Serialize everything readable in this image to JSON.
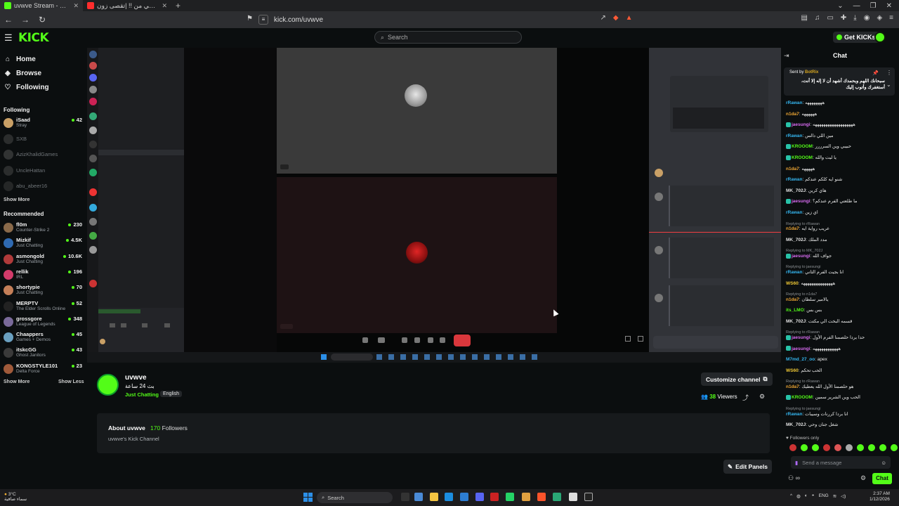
{
  "browser": {
    "tabs": [
      {
        "title": "uvwve Stream - Watch Live on K",
        "active": true
      },
      {
        "title": "الاستقاضي من !! |تقصى زون - YouTube",
        "active": false
      }
    ],
    "url": "kick.com/uvwve"
  },
  "header": {
    "logo": "KICK",
    "search_placeholder": "Search",
    "get_kicks": "Get KICKs"
  },
  "sidebar": {
    "nav": [
      {
        "label": "Home",
        "icon": "home-icon"
      },
      {
        "label": "Browse",
        "icon": "compass-icon"
      },
      {
        "label": "Following",
        "icon": "heart-icon"
      }
    ],
    "following_heading": "Following",
    "following": [
      {
        "name": "iSaad",
        "category": "Stray",
        "viewers": "42",
        "live": true,
        "color": "#c9a066"
      },
      {
        "name": "SXB",
        "category": "",
        "viewers": "",
        "live": false,
        "color": "#666"
      },
      {
        "name": "AzizKhalidGames",
        "category": "",
        "viewers": "",
        "live": false,
        "color": "#777"
      },
      {
        "name": "UncleHattan",
        "category": "",
        "viewers": "",
        "live": false,
        "color": "#666"
      },
      {
        "name": "abu_abeer16",
        "category": "",
        "viewers": "",
        "live": false,
        "color": "#555"
      }
    ],
    "show_more": "Show More",
    "recommended_heading": "Recommended",
    "recommended": [
      {
        "name": "fl0m",
        "category": "Counter-Strike 2",
        "viewers": "230",
        "color": "#8a6a4a"
      },
      {
        "name": "Mizkif",
        "category": "Just Chatting",
        "viewers": "4.5K",
        "color": "#2f6ab1"
      },
      {
        "name": "asmongold",
        "category": "Just Chatting",
        "viewers": "10.6K",
        "color": "#b03a3a"
      },
      {
        "name": "rellik",
        "category": "IRL",
        "viewers": "196",
        "color": "#d23b6a"
      },
      {
        "name": "shortypie",
        "category": "Just Chatting",
        "viewers": "70",
        "color": "#c47f58"
      },
      {
        "name": "MERPTV",
        "category": "The Elder Scrolls Online",
        "viewers": "52",
        "color": "#222"
      },
      {
        "name": "grossgore",
        "category": "League of Legends",
        "viewers": "348",
        "color": "#7a6a9a"
      },
      {
        "name": "Chaappers",
        "category": "Games + Demos",
        "viewers": "45",
        "color": "#6aa0c0"
      },
      {
        "name": "itskcGG",
        "category": "Ghost Janitors",
        "viewers": "43",
        "color": "#3a3a3a"
      },
      {
        "name": "KONGSTYLE101",
        "category": "Delta Force",
        "viewers": "23",
        "color": "#a05a3a"
      }
    ],
    "show_more_bottom": "Show More",
    "show_less": "Show Less"
  },
  "stream": {
    "channel": "uvwve",
    "title": "بث 24 ساعة",
    "category": "Just Chatting",
    "language": "English",
    "customize": "Customize channel",
    "viewers_count": "38",
    "viewers_label": "Viewers",
    "about_label": "About uvwve",
    "followers_count": "170",
    "followers_label": "Followers",
    "description": "uvwve's Kick Channel",
    "edit_panels": "Edit Panels"
  },
  "chat": {
    "title": "Chat",
    "pinned_by_label": "Sent by",
    "pinned_by": "BotRix",
    "pinned_text": "سبحانك اللهم وبحمدك أشهد أن لا إله إلا أنت، أستغفرك وأتوب إليك",
    "messages": [
      {
        "user": "rRawan",
        "text": ": ههههههههه",
        "color": "#35b6f0"
      },
      {
        "user": "n1da7",
        "text": ": ههههههه",
        "color": "#f0a835"
      },
      {
        "user": "jaesungi",
        "text": ": هههههههههههههههههههه",
        "color": "#d76bf0",
        "badge": true
      },
      {
        "user": "rRawan",
        "text": ": مين اللي دالس",
        "color": "#35b6f0"
      },
      {
        "user": "KROOOM",
        "text": ": حبيبي وين السرررر",
        "color": "#53fc18",
        "badge": true
      },
      {
        "user": "KROOOM",
        "text": ": يا ليت والله",
        "color": "#53fc18",
        "badge": true
      },
      {
        "user": "n1da7",
        "text": ": هههههه",
        "color": "#f0a835"
      },
      {
        "user": "rRawan",
        "text": ": شنو ايه كلكم عندكم",
        "color": "#35b6f0"
      },
      {
        "user": "MK_702J",
        "text": ": هاي كرين",
        "color": "#e0e0e0"
      },
      {
        "user": "jaesungi",
        "text": ": ما طلعتي الفرم عندكم؟",
        "color": "#d76bf0",
        "badge": true
      },
      {
        "user": "rRawan",
        "text": ": اي زين",
        "color": "#35b6f0"
      },
      {
        "user": "n1da7",
        "text": ": عريب رواية ايه",
        "color": "#f0a835",
        "reply": "Replying to rRawan"
      },
      {
        "user": "MK_702J",
        "text": ": مدد الملك",
        "color": "#e0e0e0"
      },
      {
        "user": "jaesungi",
        "text": ": جواف الله",
        "color": "#d76bf0",
        "badge": true,
        "reply": "Replying to MK_702J"
      },
      {
        "user": "rRawan",
        "text": ": انا بجيت الفرم الثاني",
        "color": "#35b6f0",
        "reply": "Replying to jaesungi"
      },
      {
        "user": "WS60",
        "text": ": هههههههههههههههه",
        "color": "#f0c935"
      },
      {
        "user": "n1da7",
        "text": ": يالامير سلطان",
        "color": "#f0a835",
        "reply": "Replying to n1da7"
      },
      {
        "user": "its_LMO",
        "text": ": بس بس",
        "color": "#53fc18"
      },
      {
        "user": "MK_702J",
        "text": ": قسمه البخت الي مكتت",
        "color": "#e0e0e0"
      },
      {
        "user": "jaesungi",
        "text": ": حدا يردا حلصمنا الفرم الأول",
        "color": "#d76bf0",
        "badge": true,
        "reply": "Replying to rRawan"
      },
      {
        "user": "jaesungi",
        "text": ": ههههههههههههه",
        "color": "#d76bf0",
        "badge": true
      },
      {
        "user": "M7md_27_oo",
        "text": ": apex",
        "color": "#35b6f0"
      },
      {
        "user": "WS60",
        "text": ": الحب تحكم",
        "color": "#f0c935"
      },
      {
        "user": "n1da7",
        "text": ": هو حلصمنا الأول الله يعطيك",
        "color": "#f0a835",
        "reply": "Replying to rRawan"
      },
      {
        "user": "KROOOM",
        "text": ": الحب وين الشرير سمين",
        "color": "#53fc18",
        "badge": true
      },
      {
        "user": "rRawan",
        "text": ": انا بردا كررنات وسيبات",
        "color": "#35b6f0",
        "reply": "Replying to jaesungi"
      },
      {
        "user": "MK_702J",
        "text": ": شغل جنان وحي",
        "color": "#e0e0e0"
      }
    ],
    "followers_only": "Followers only",
    "send_placeholder": "Send a message",
    "chat_button": "Chat"
  },
  "taskbar": {
    "temp": "3°C",
    "weather": "سماء صافية",
    "search": "Search",
    "lang": "ENG",
    "time": "2:37 AM",
    "date": "1/12/2026"
  }
}
